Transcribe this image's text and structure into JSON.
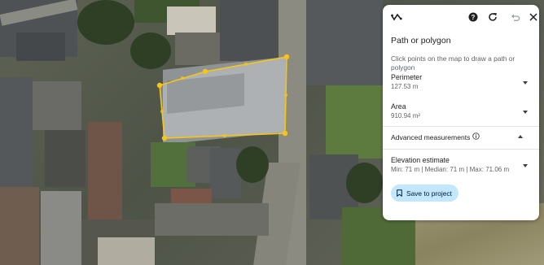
{
  "panel": {
    "title": "Path or polygon",
    "hint": "Click points on the map to draw a path or polygon",
    "perimeter": {
      "label": "Perimeter",
      "value": "127.53 m"
    },
    "area": {
      "label": "Area",
      "value": "910.94 m²"
    },
    "advanced": {
      "label": "Advanced measurements"
    },
    "elevation": {
      "label": "Elevation estimate",
      "value": "Min: 71 m | Median: 71 m | Max: 71.06 m"
    },
    "save_label": "Save to project"
  },
  "toolbar": {
    "icons": [
      "ruler-icon",
      "help-icon",
      "refresh-icon",
      "undo-icon",
      "close-icon"
    ]
  },
  "colors": {
    "polygon_stroke": "#f5c518",
    "polygon_fill": "rgba(255,255,255,0.28)",
    "save_button_bg": "#c2e7ff"
  }
}
